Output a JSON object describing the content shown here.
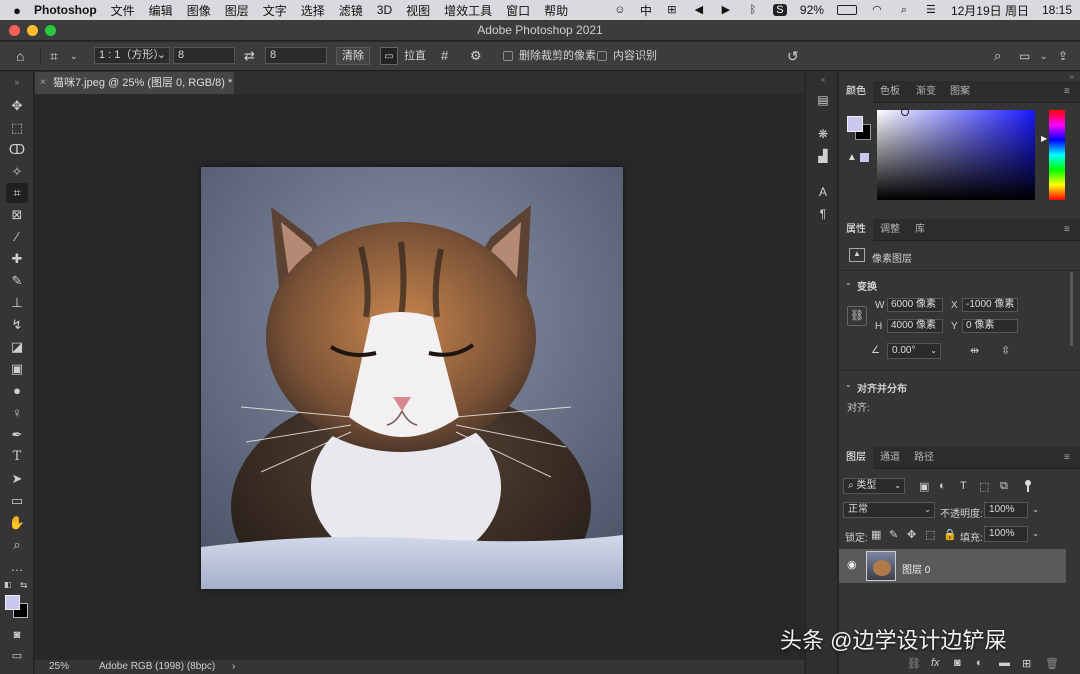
{
  "menubar": {
    "app": "Photoshop",
    "items": [
      "文件",
      "编辑",
      "图像",
      "图层",
      "文字",
      "选择",
      "滤镜",
      "3D",
      "视图",
      "增效工具",
      "窗口",
      "帮助"
    ],
    "input_method": "中",
    "battery": "92%",
    "date": "12月19日 周日",
    "time": "18:15"
  },
  "window": {
    "title": "Adobe Photoshop 2021"
  },
  "options": {
    "ratio": "1 : 1（方形）",
    "width_value": "8",
    "height_value": "8",
    "clear_label": "清除",
    "straighten_label": "拉直",
    "delete_cropped_label": "删除裁剪的像素",
    "content_aware_label": "内容识别"
  },
  "document": {
    "tab_label": "猫咪7.jpeg @ 25% (图层 0, RGB/8) *",
    "zoom": "25%",
    "color_profile": "Adobe RGB (1998) (8bpc)"
  },
  "color_panel": {
    "tabs": [
      "颜色",
      "色板",
      "渐变",
      "图案"
    ],
    "foreground": "#c8c8f0",
    "background": "#000000"
  },
  "properties_panel": {
    "tabs": [
      "属性",
      "调整",
      "库"
    ],
    "layer_type": "像素图层",
    "transform_title": "变换",
    "w_label": "W",
    "w_value": "6000 像素",
    "x_label": "X",
    "x_value": "-1000 像素",
    "h_label": "H",
    "h_value": "4000 像素",
    "y_label": "Y",
    "y_value": "0 像素",
    "angle_value": "0.00°",
    "align_title": "对齐并分布",
    "align_label": "对齐:"
  },
  "layers_panel": {
    "tabs": [
      "图层",
      "通道",
      "路径"
    ],
    "filter_label": "类型",
    "blend_mode": "正常",
    "opacity_label": "不透明度:",
    "opacity_value": "100%",
    "lock_label": "锁定:",
    "fill_label": "填充:",
    "fill_value": "100%",
    "layers": [
      {
        "name": "图层 0"
      }
    ]
  },
  "watermark": "头条 @边学设计边铲屎"
}
